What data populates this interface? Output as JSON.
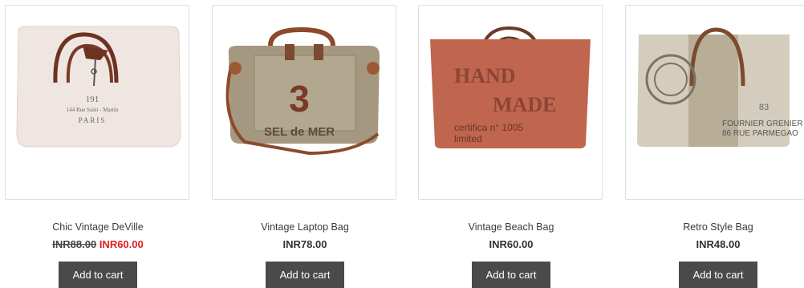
{
  "products": [
    {
      "name": "Chic Vintage DeVille",
      "price_old": "INR88.00",
      "price": "INR60.00",
      "cta": "Add to cart",
      "image_text": [
        "191",
        "144 Rue Saint - Martin",
        "PARIS"
      ],
      "image_colors": {
        "canvas": "#efe6e2",
        "leather": "#6e3222"
      }
    },
    {
      "name": "Vintage Laptop Bag",
      "price": "INR78.00",
      "cta": "Add to cart",
      "image_text": [
        "3",
        "SEL de MER"
      ],
      "image_colors": {
        "canvas": "#a59880",
        "leather": "#8b4a2b"
      }
    },
    {
      "name": "Vintage Beach Bag",
      "price": "INR60.00",
      "cta": "Add to cart",
      "image_text": [
        "HAND",
        "MADE",
        "certifica n° 1005",
        "limited"
      ],
      "image_colors": {
        "canvas": "#c0664f",
        "leather": "#6a3a28"
      }
    },
    {
      "name": "Retro Style Bag",
      "price": "INR48.00",
      "cta": "Add to cart",
      "image_text": [
        "FOURNIER GRENIER",
        "86 RUE PARMEGAO",
        "83"
      ],
      "image_colors": {
        "canvas": "#d4cdbd",
        "leather": "#7c4a2f"
      }
    }
  ],
  "theme": {
    "button_bg": "#4a4a4a",
    "sale_color": "#e02020",
    "border": "#dedede"
  }
}
